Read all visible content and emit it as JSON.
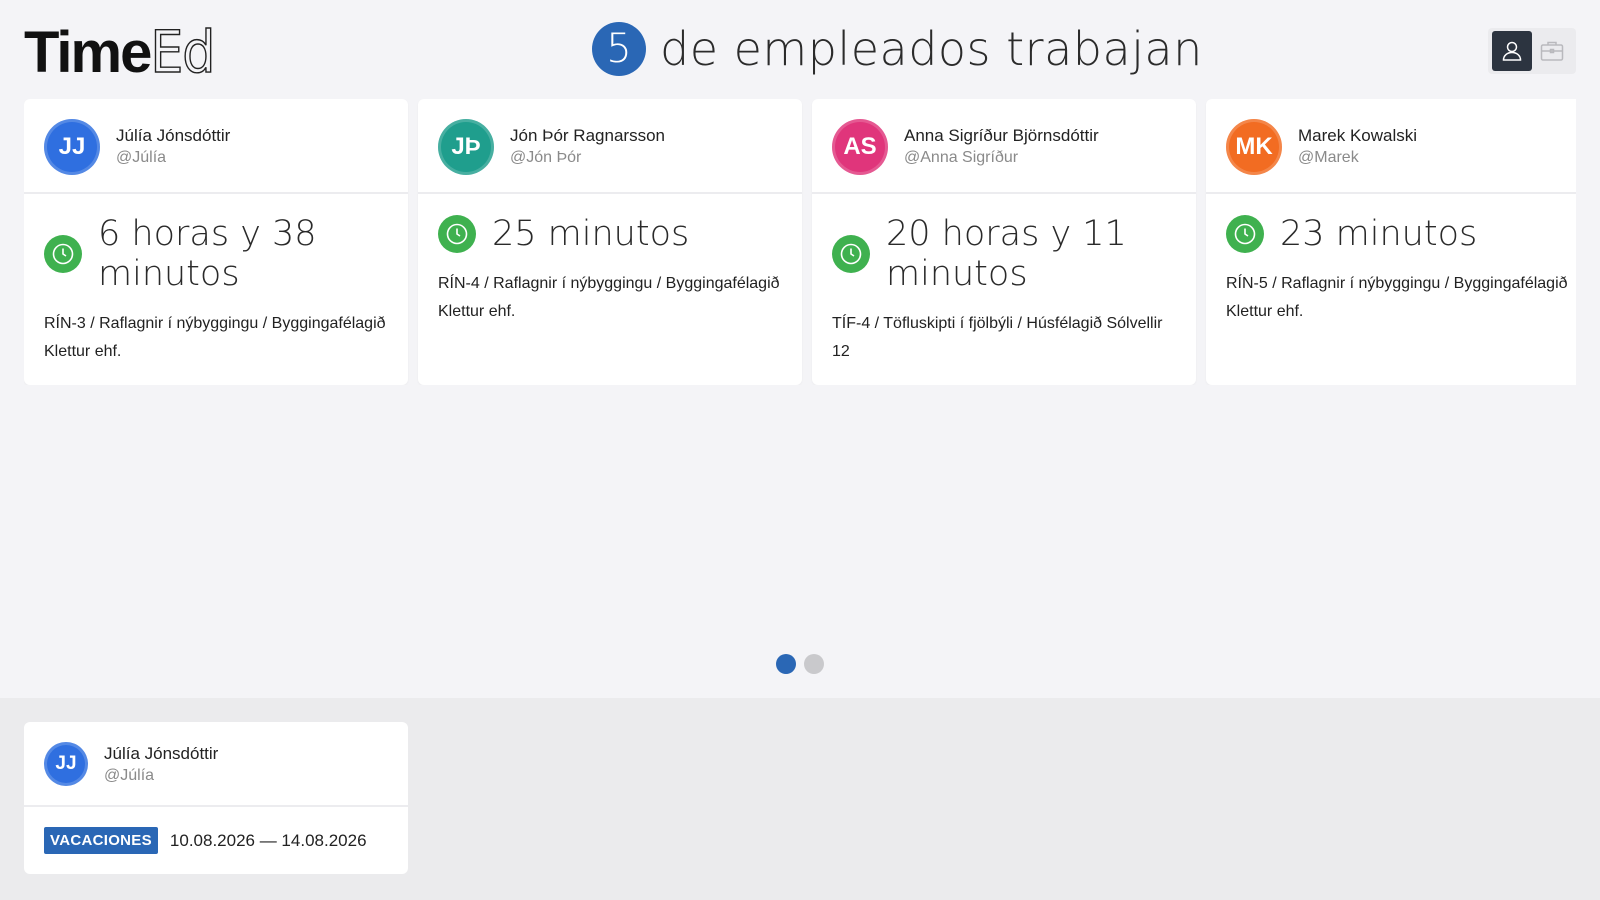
{
  "app": {
    "logo_bold": "Time",
    "logo_thin": "Ed"
  },
  "header": {
    "working_count": "5",
    "headline": "de empleados trabajan",
    "view_toggle": [
      {
        "icon": "user-icon",
        "active": true
      },
      {
        "icon": "briefcase-icon",
        "active": false
      }
    ]
  },
  "employees": [
    {
      "initials": "JJ",
      "avatar_color": "#2f6fe0",
      "name": "Júlía Jónsdóttir",
      "handle": "@Júlía",
      "duration": "6 horas y 38 minutos",
      "task": "RÍN-3 / Raflagnir í nýbyggingu / Byggingafélagið Klettur ehf."
    },
    {
      "initials": "JÞ",
      "avatar_color": "#1f9e8d",
      "name": "Jón Þór Ragnarsson",
      "handle": "@Jón Þór",
      "duration": "25 minutos",
      "task": "RÍN-4 / Raflagnir í nýbyggingu / Byggingafélagið Klettur ehf."
    },
    {
      "initials": "AS",
      "avatar_color": "#e0357b",
      "name": "Anna Sigríður Björnsdóttir",
      "handle": "@Anna Sigríður",
      "duration": "20 horas y 11 minutos",
      "task": "TÍF-4 / Töfluskipti í fjölbýli / Húsfélagið Sólvellir 12"
    },
    {
      "initials": "MK",
      "avatar_color": "#f26c22",
      "name": "Marek Kowalski",
      "handle": "@Marek",
      "duration": "23 minutos",
      "task": "RÍN-5 / Raflagnir í nýbyggingu / Byggingafélagið Klettur ehf."
    }
  ],
  "pagination": {
    "pages": 2,
    "current": 1
  },
  "absences": [
    {
      "initials": "JJ",
      "avatar_color": "#2f6fe0",
      "name": "Júlía Jónsdóttir",
      "handle": "@Júlía",
      "type": "VACACIONES",
      "dates": "10.08.2026 — 14.08.2026"
    }
  ],
  "colors": {
    "accent": "#2a67b5",
    "status_working": "#3fb14f",
    "background": "#f4f4f7"
  }
}
